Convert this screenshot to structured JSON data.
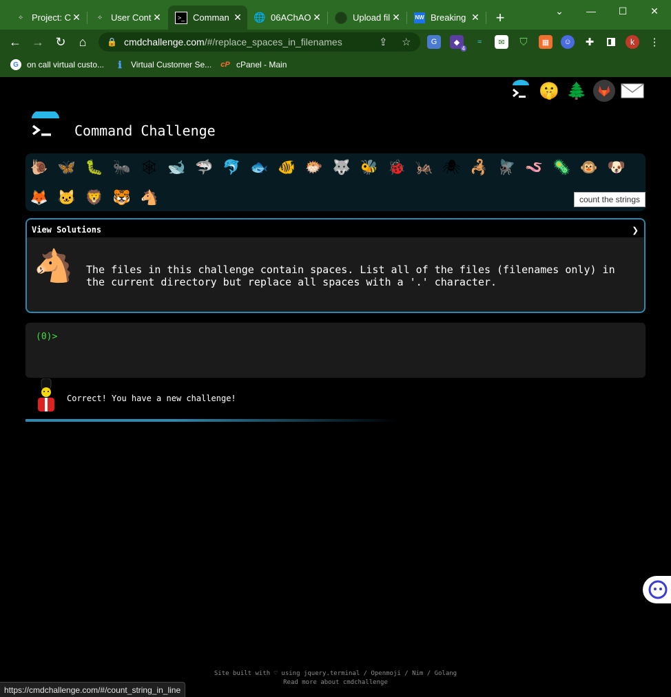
{
  "browser": {
    "tabs": [
      {
        "title": "Project: C",
        "favicon": "gitlab-icon",
        "active": false
      },
      {
        "title": "User Cont",
        "favicon": "gitlab-icon",
        "active": false
      },
      {
        "title": "Comman",
        "favicon": "terminal-icon",
        "active": true
      },
      {
        "title": "06AChAO",
        "favicon": "globe-icon",
        "active": false
      },
      {
        "title": "Upload fil",
        "favicon": "github-icon",
        "active": false
      },
      {
        "title": "Breaking",
        "favicon": "nw-icon",
        "active": false
      }
    ],
    "tab_close_glyph": "✕",
    "new_tab_glyph": "+",
    "window_controls": {
      "minimize": "—",
      "maximize": "☐",
      "close": "✕",
      "dropdown": "⌄"
    },
    "omnibox": {
      "url_host": "cmdchallenge.com",
      "url_path": "/#/replace_spaces_in_filenames"
    },
    "profile_initial": "k",
    "bookmarks": [
      {
        "label": "on call virtual custo...",
        "icon": "google-icon"
      },
      {
        "label": "Virtual Customer Se...",
        "icon": "info-icon"
      },
      {
        "label": "cPanel - Main",
        "icon": "cpanel-icon"
      }
    ],
    "extension_badge": "4",
    "status_url": "https://cmdchallenge.com/#/count_string_in_line",
    "colors": {
      "frame": "#2c6b23",
      "toolbar": "#1f4e18"
    }
  },
  "page": {
    "title": "Command Challenge",
    "tooltip": "count the strings",
    "challenge": {
      "header": "View Solutions",
      "description": "The files in this challenge contain spaces. List all of the files (filenames only) in the current directory but replace all spaces with a '.' character."
    },
    "terminal": {
      "prompt": "(0)>"
    },
    "feedback": "Correct! You have a new challenge!",
    "footer": {
      "line1": "Site built with ♡ using jquery.terminal / Openmoji / Nim / Golang",
      "line2": "Read more about cmdchallenge"
    },
    "animals_row1": [
      "snail",
      "butterfly",
      "caterpillar",
      "ant",
      "spider-web",
      "whale",
      "shark",
      "dolphin",
      "fish",
      "tropical-fish",
      "blowfish",
      "wolf",
      "bee",
      "lady-beetle",
      "cricket",
      "spider",
      "scorpion",
      "fly",
      "worm",
      "microbe",
      "monkey-face",
      "dog-face"
    ],
    "animals_row2": [
      "fox-face",
      "cat-face",
      "lion-face",
      "tiger-face",
      "horse-face"
    ],
    "colors": {
      "accent": "#2a8ab0",
      "prompt": "#3ee03e",
      "panel": "#1b1b1b",
      "animal_bar": "#061b22"
    }
  }
}
